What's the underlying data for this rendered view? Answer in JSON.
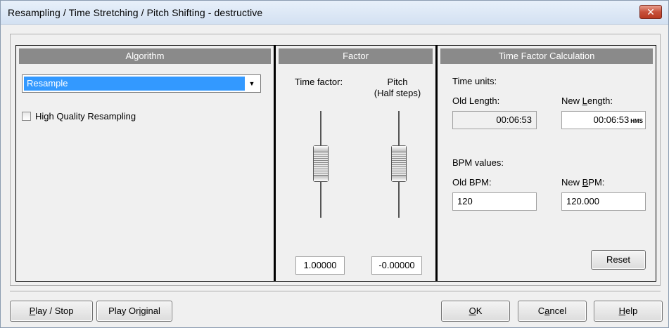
{
  "window": {
    "title": "Resampling / Time Stretching / Pitch Shifting - destructive",
    "close_glyph": "✕"
  },
  "algorithm": {
    "header": "Algorithm",
    "selected": "Resample",
    "arrow_glyph": "▼",
    "checkbox_label": "High Quality Resampling",
    "checkbox_checked": false
  },
  "factor": {
    "header": "Factor",
    "time_factor_label": "Time factor:",
    "pitch_label_line1": "Pitch",
    "pitch_label_line2": "(Half steps)",
    "time_factor_value": "1.00000",
    "pitch_value": "-0.00000"
  },
  "time_calc": {
    "header": "Time Factor Calculation",
    "time_units_label": "Time units:",
    "old_length_label": "Old Length:",
    "new_length_label_pre": "New ",
    "new_length_label_underline": "L",
    "new_length_label_post": "ength:",
    "old_length_value": "00:06:53",
    "new_length_value": "00:06:53",
    "hms_suffix": "HMS",
    "bpm_values_label": "BPM values:",
    "old_bpm_label": "Old BPM:",
    "new_bpm_label_pre": "New ",
    "new_bpm_label_underline": "B",
    "new_bpm_label_post": "PM:",
    "old_bpm_value": "120",
    "new_bpm_value": "120.000",
    "reset_label": "Reset"
  },
  "buttons": {
    "play_stop_underline": "P",
    "play_stop_rest": "lay / Stop",
    "play_original_pre": "Play Or",
    "play_original_underline": "i",
    "play_original_post": "ginal",
    "ok_underline": "O",
    "ok_rest": "K",
    "cancel_pre": "C",
    "cancel_underline": "a",
    "cancel_post": "ncel",
    "help_underline": "H",
    "help_rest": "elp"
  }
}
